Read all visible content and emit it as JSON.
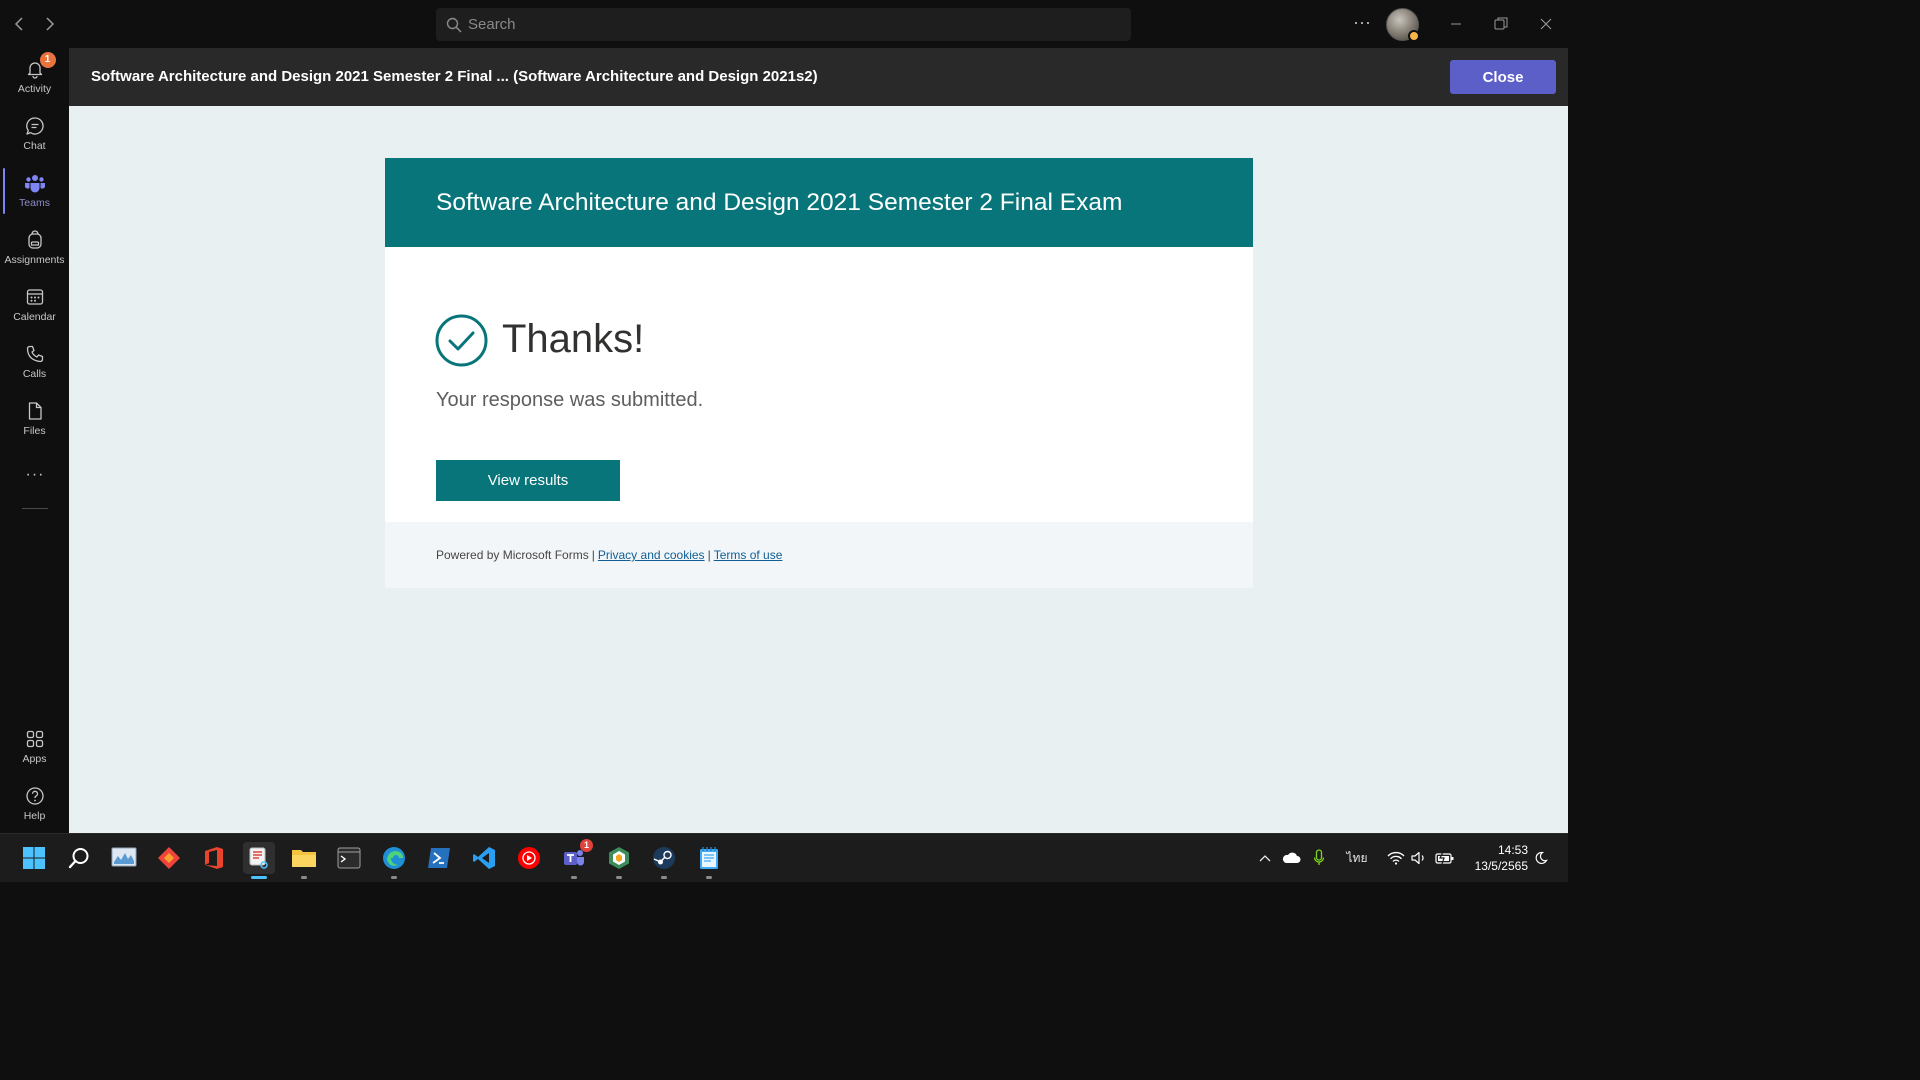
{
  "titlebar": {
    "search_placeholder": "Search",
    "more_label": "···"
  },
  "rail": {
    "items": [
      {
        "label": "Activity",
        "badge": "1"
      },
      {
        "label": "Chat"
      },
      {
        "label": "Teams"
      },
      {
        "label": "Assignments"
      },
      {
        "label": "Calendar"
      },
      {
        "label": "Calls"
      },
      {
        "label": "Files"
      }
    ],
    "more": "···",
    "bottom": [
      {
        "label": "Apps"
      },
      {
        "label": "Help"
      }
    ]
  },
  "header": {
    "title": "Software Architecture and Design 2021 Semester 2 Final ... (Software Architecture and Design 2021s2)",
    "close_label": "Close"
  },
  "form": {
    "title": "Software Architecture and Design 2021 Semester 2 Final Exam",
    "thanks": "Thanks!",
    "message": "Your response was submitted.",
    "view_results_label": "View results",
    "footer": {
      "powered": "Powered by Microsoft Forms",
      "separator": "|",
      "privacy": "Privacy and cookies",
      "terms": "Terms of use"
    }
  },
  "taskbar": {
    "teams_badge": "1",
    "language": "ไทย",
    "time": "14:53",
    "date": "13/5/2565"
  },
  "colors": {
    "teams_accent": "#5b5fc7",
    "forms_teal": "#077579",
    "activity_badge": "#e8733f"
  }
}
